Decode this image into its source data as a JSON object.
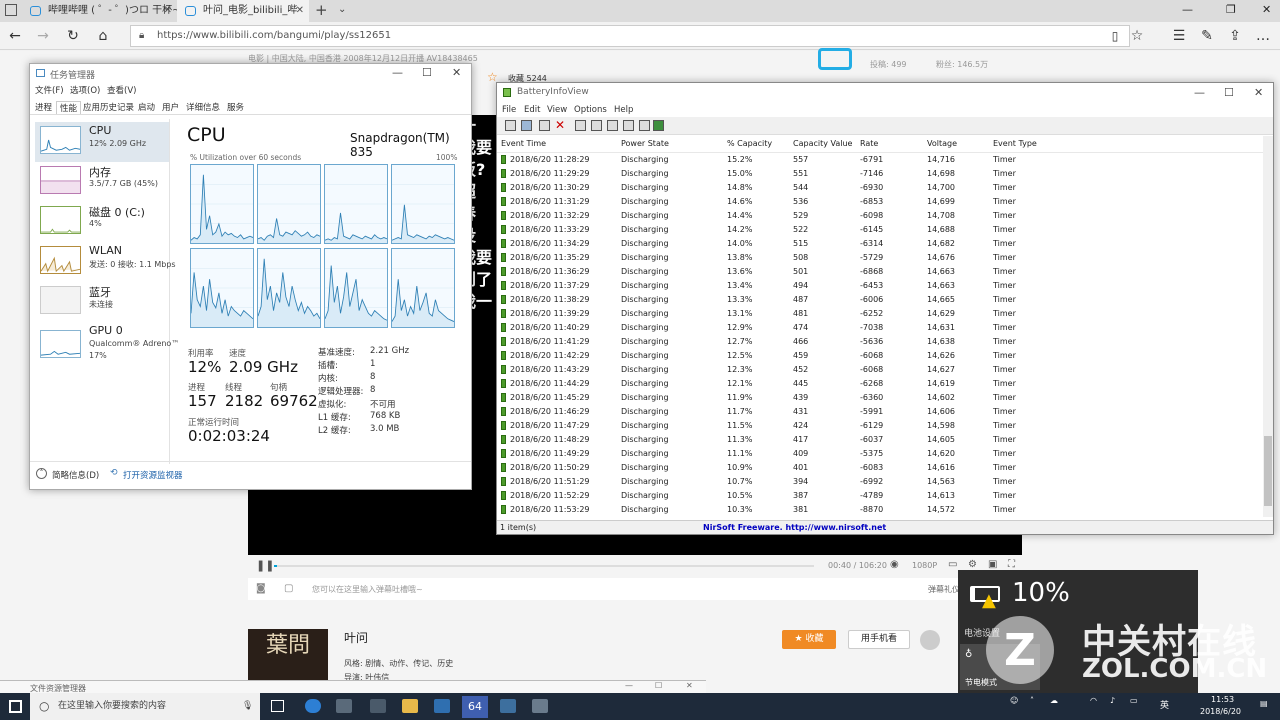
{
  "browser": {
    "tabs": [
      {
        "label": "哔哩哔哩 ( ゜- ゜)つロ 干杯~"
      },
      {
        "label": "叶问_电影_bilibili_哔"
      }
    ],
    "url": "https://www.bilibili.com/bangumi/play/ss12651",
    "new_tab": "+"
  },
  "page": {
    "meta": "电影  |  中国大陆, 中国香港  2008年12月12日开播  AV18438465",
    "favorite_count": "收藏 5244",
    "playback_count": "投稿: 499",
    "fans": "粉丝: 146.5万",
    "subtitles": [
      "一",
      "我要",
      "饭?",
      "超",
      "春",
      "没",
      "我要",
      "到了",
      "我一"
    ],
    "time": "00:40 / 106:20",
    "quality": "1080P",
    "danmu_placeholder": "您可以在这里输入弹幕吐槽哦~",
    "danmu_etiquette": "弹幕礼仪",
    "title": "叶问",
    "style": "风格: 剧情、动作、传记、历史",
    "director": "导演: 叶伟信",
    "favorite_btn": "收藏",
    "mobile_btn": "用手机看",
    "poster_text": "葉問"
  },
  "taskmgr": {
    "title": "任务管理器",
    "menu": [
      "文件(F)",
      "选项(O)",
      "查看(V)"
    ],
    "tabs": [
      "进程",
      "性能",
      "应用历史记录",
      "启动",
      "用户",
      "详细信息",
      "服务"
    ],
    "resources": [
      {
        "name": "CPU",
        "value": "12% 2.09 GHz"
      },
      {
        "name": "内存",
        "value": "3.5/7.7 GB (45%)"
      },
      {
        "name": "磁盘 0 (C:)",
        "value": "4%"
      },
      {
        "name": "WLAN",
        "value": "发送: 0 接收: 1.1 Mbps"
      },
      {
        "name": "蓝牙",
        "value": "未连接"
      },
      {
        "name": "GPU 0",
        "value": "Qualcomm® Adreno™",
        "value2": "17%"
      }
    ],
    "cpu_title": "CPU",
    "cpu_model": "Snapdragon(TM) 835",
    "util_label": "% Utilization over 60 seconds",
    "util_max": "100%",
    "stats": {
      "util_label": "利用率",
      "util": "12%",
      "speed_label": "速度",
      "speed": "2.09 GHz",
      "proc_label": "进程",
      "proc": "157",
      "thread_label": "线程",
      "thread": "2182",
      "handle_label": "句柄",
      "handle": "69762",
      "uptime_label": "正常运行时间",
      "uptime": "0:02:03:24"
    },
    "details": [
      {
        "k": "基准速度:",
        "v": "2.21 GHz"
      },
      {
        "k": "插槽:",
        "v": "1"
      },
      {
        "k": "内核:",
        "v": "8"
      },
      {
        "k": "逻辑处理器:",
        "v": "8"
      },
      {
        "k": "虚拟化:",
        "v": "不可用"
      },
      {
        "k": "L1 缓存:",
        "v": "768 KB"
      },
      {
        "k": "L2 缓存:",
        "v": "3.0 MB"
      }
    ],
    "footer_less": "简略信息(D)",
    "footer_monitor": "打开资源监视器"
  },
  "battery": {
    "title": "BatteryInfoView",
    "menu": [
      "File",
      "Edit",
      "View",
      "Options",
      "Help"
    ],
    "columns": [
      "Event Time",
      "Power State",
      "% Capacity",
      "Capacity Value",
      "Rate",
      "Voltage",
      "Event Type"
    ],
    "rows": [
      [
        "2018/6/20 11:28:29",
        "Discharging",
        "15.2%",
        "557",
        "-6791",
        "14,716",
        "Timer"
      ],
      [
        "2018/6/20 11:29:29",
        "Discharging",
        "15.0%",
        "551",
        "-7146",
        "14,698",
        "Timer"
      ],
      [
        "2018/6/20 11:30:29",
        "Discharging",
        "14.8%",
        "544",
        "-6930",
        "14,700",
        "Timer"
      ],
      [
        "2018/6/20 11:31:29",
        "Discharging",
        "14.6%",
        "536",
        "-6853",
        "14,699",
        "Timer"
      ],
      [
        "2018/6/20 11:32:29",
        "Discharging",
        "14.4%",
        "529",
        "-6098",
        "14,708",
        "Timer"
      ],
      [
        "2018/6/20 11:33:29",
        "Discharging",
        "14.2%",
        "522",
        "-6145",
        "14,688",
        "Timer"
      ],
      [
        "2018/6/20 11:34:29",
        "Discharging",
        "14.0%",
        "515",
        "-6314",
        "14,682",
        "Timer"
      ],
      [
        "2018/6/20 11:35:29",
        "Discharging",
        "13.8%",
        "508",
        "-5729",
        "14,676",
        "Timer"
      ],
      [
        "2018/6/20 11:36:29",
        "Discharging",
        "13.6%",
        "501",
        "-6868",
        "14,663",
        "Timer"
      ],
      [
        "2018/6/20 11:37:29",
        "Discharging",
        "13.4%",
        "494",
        "-6453",
        "14,663",
        "Timer"
      ],
      [
        "2018/6/20 11:38:29",
        "Discharging",
        "13.3%",
        "487",
        "-6006",
        "14,665",
        "Timer"
      ],
      [
        "2018/6/20 11:39:29",
        "Discharging",
        "13.1%",
        "481",
        "-6252",
        "14,629",
        "Timer"
      ],
      [
        "2018/6/20 11:40:29",
        "Discharging",
        "12.9%",
        "474",
        "-7038",
        "14,631",
        "Timer"
      ],
      [
        "2018/6/20 11:41:29",
        "Discharging",
        "12.7%",
        "466",
        "-5636",
        "14,638",
        "Timer"
      ],
      [
        "2018/6/20 11:42:29",
        "Discharging",
        "12.5%",
        "459",
        "-6068",
        "14,626",
        "Timer"
      ],
      [
        "2018/6/20 11:43:29",
        "Discharging",
        "12.3%",
        "452",
        "-6068",
        "14,627",
        "Timer"
      ],
      [
        "2018/6/20 11:44:29",
        "Discharging",
        "12.1%",
        "445",
        "-6268",
        "14,619",
        "Timer"
      ],
      [
        "2018/6/20 11:45:29",
        "Discharging",
        "11.9%",
        "439",
        "-6360",
        "14,602",
        "Timer"
      ],
      [
        "2018/6/20 11:46:29",
        "Discharging",
        "11.7%",
        "431",
        "-5991",
        "14,606",
        "Timer"
      ],
      [
        "2018/6/20 11:47:29",
        "Discharging",
        "11.5%",
        "424",
        "-6129",
        "14,598",
        "Timer"
      ],
      [
        "2018/6/20 11:48:29",
        "Discharging",
        "11.3%",
        "417",
        "-6037",
        "14,605",
        "Timer"
      ],
      [
        "2018/6/20 11:49:29",
        "Discharging",
        "11.1%",
        "409",
        "-5375",
        "14,620",
        "Timer"
      ],
      [
        "2018/6/20 11:50:29",
        "Discharging",
        "10.9%",
        "401",
        "-6083",
        "14,616",
        "Timer"
      ],
      [
        "2018/6/20 11:51:29",
        "Discharging",
        "10.7%",
        "394",
        "-6992",
        "14,563",
        "Timer"
      ],
      [
        "2018/6/20 11:52:29",
        "Discharging",
        "10.5%",
        "387",
        "-4789",
        "14,613",
        "Timer"
      ],
      [
        "2018/6/20 11:53:29",
        "Discharging",
        "10.3%",
        "381",
        "-8870",
        "14,572",
        "Timer"
      ]
    ],
    "status_items": "1 item(s)",
    "status_credit": "NirSoft Freeware.  http://www.nirsoft.net"
  },
  "flyout": {
    "percent": "10%",
    "settings": "电池设置",
    "saver": "节电模式"
  },
  "bottom_window": {
    "title": "文件资源管理器"
  },
  "taskbar": {
    "search": "在这里输入你要搜索的内容",
    "app_label": "64",
    "time": "11:53",
    "date": "2018/6/20",
    "lang": "英"
  },
  "watermark": {
    "cn": "中关村在线",
    "en": "ZOL.COM.CN"
  },
  "colors": {
    "graph": "#2f80b5",
    "graph_fill": "#d9ebf7",
    "accent": "#f08a24",
    "taskbar": "#1e2a3a"
  }
}
